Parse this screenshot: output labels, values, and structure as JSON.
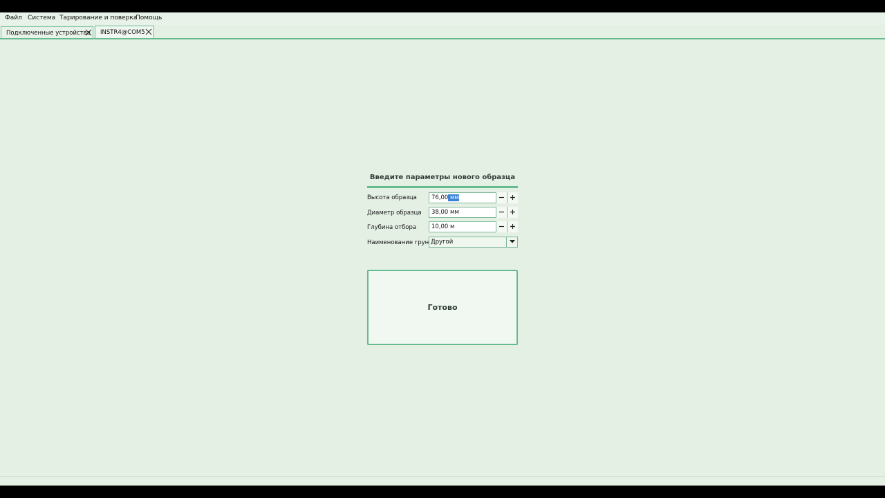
{
  "menu": {
    "items": [
      "Файл",
      "Система",
      "Тарирование и поверка",
      "Помощь"
    ]
  },
  "tabs": [
    {
      "label": "Подключенные устройства",
      "active": false
    },
    {
      "label": "INSTR4@COM5",
      "active": true
    }
  ],
  "form": {
    "title": "Введите параметры нового образца",
    "fields": [
      {
        "label": "Высота образца",
        "value_plain": "76,00",
        "value_selected": " мм"
      },
      {
        "label": "Диаметр образца",
        "value": "38,00 мм"
      },
      {
        "label": "Глубина отбора",
        "value": "10,00 м"
      },
      {
        "label": "Наименование грунта",
        "value": "Другой"
      }
    ],
    "done_label": "Готово"
  },
  "colors": {
    "accent": "#66bb8e",
    "background": "#e5f0e5",
    "selection": "#3b82d6"
  },
  "icons": {
    "close": "close-icon",
    "minus": "minus-icon",
    "plus": "plus-icon",
    "dropdown": "chevron-down-icon"
  }
}
